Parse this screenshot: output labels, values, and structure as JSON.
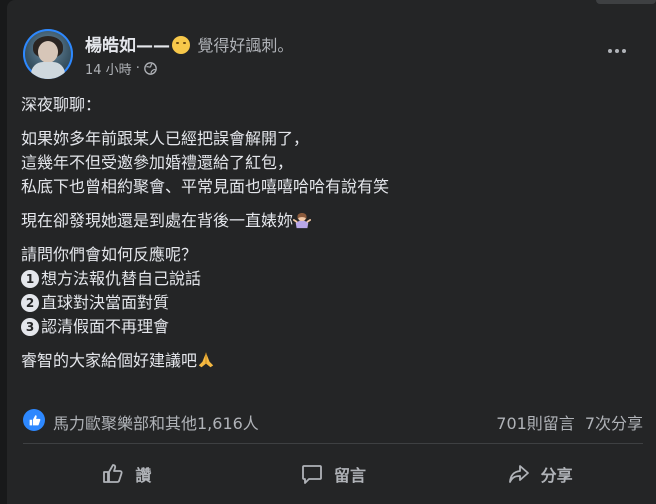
{
  "post": {
    "author": "楊皓如——",
    "feeling_text": "覺得好諷刺。",
    "timestamp": "14 小時",
    "separator": "·",
    "paragraphs": {
      "p1": "深夜聊聊：",
      "p2_l1": "如果妳多年前跟某人已經把誤會解開了，",
      "p2_l2": "這幾年不但受邀參加婚禮還給了紅包，",
      "p2_l3": "私底下也曾相約聚會、平常見面也嘻嘻哈哈有說有笑",
      "p3": "現在卻發現她還是到處在背後一直婊妳",
      "p4_l1": "請問你們會如何反應呢？",
      "opt1_num": "1",
      "opt1": "想方法報仇替自己說話",
      "opt2_num": "2",
      "opt2": "直球對決當面對質",
      "opt3_num": "3",
      "opt3": "認清假面不再理會",
      "p5": "睿智的大家給個好建議吧"
    }
  },
  "stats": {
    "reactions": "馬力歐聚樂部和其他1,616人",
    "comments": "701則留言",
    "shares": "7次分享"
  },
  "actions": {
    "like": "讚",
    "comment": "留言",
    "share": "分享"
  },
  "icons": {
    "privacy": "public-globe-icon",
    "more": "more-dots-icon",
    "like_badge": "thumbs-up-icon"
  },
  "colors": {
    "card_bg": "#242526",
    "page_bg": "#18191a",
    "text_primary": "#e4e6eb",
    "text_secondary": "#b0b3b8",
    "accent": "#2d88ff"
  }
}
